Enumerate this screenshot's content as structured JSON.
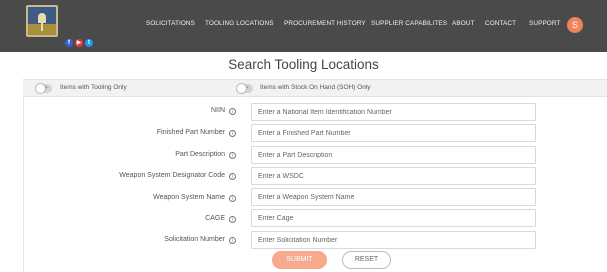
{
  "header": {
    "nav": [
      "SOLICITATIONS",
      "TOOLING LOCATIONS",
      "PROCUREMENT HISTORY",
      "SUPPLIER CAPABILITES",
      "ABOUT",
      "CONTACT",
      "SUPPORT"
    ],
    "user_initial": "S",
    "social": [
      "f",
      "▶",
      "t"
    ]
  },
  "page": {
    "title": "Search Tooling Locations"
  },
  "toggles": [
    {
      "label": "Items with Tooling Only",
      "state": "off"
    },
    {
      "label": "Items with Stock On Hand (SOH) Only",
      "state": "off"
    }
  ],
  "fields": [
    {
      "label": "NIIN",
      "placeholder": "Enter a National Item Identification Number"
    },
    {
      "label": "Finished Part Number",
      "placeholder": "Enter a Finished Part Number"
    },
    {
      "label": "Part Description",
      "placeholder": "Enter a Part Description"
    },
    {
      "label": "Weapon System Designator Code",
      "placeholder": "Enter a WSDC"
    },
    {
      "label": "Weapon System Name",
      "placeholder": "Enter a Weapon System Name"
    },
    {
      "label": "CAGE",
      "placeholder": "Enter Cage"
    },
    {
      "label": "Solicitation Number",
      "placeholder": "Enter Solicitation Number"
    }
  ],
  "buttons": {
    "submit": "SUBMIT",
    "reset": "RESET"
  },
  "colors": {
    "header_bg": "#4a4a4a",
    "accent": "#f0835a",
    "submit_bg": "#f6a98c"
  }
}
